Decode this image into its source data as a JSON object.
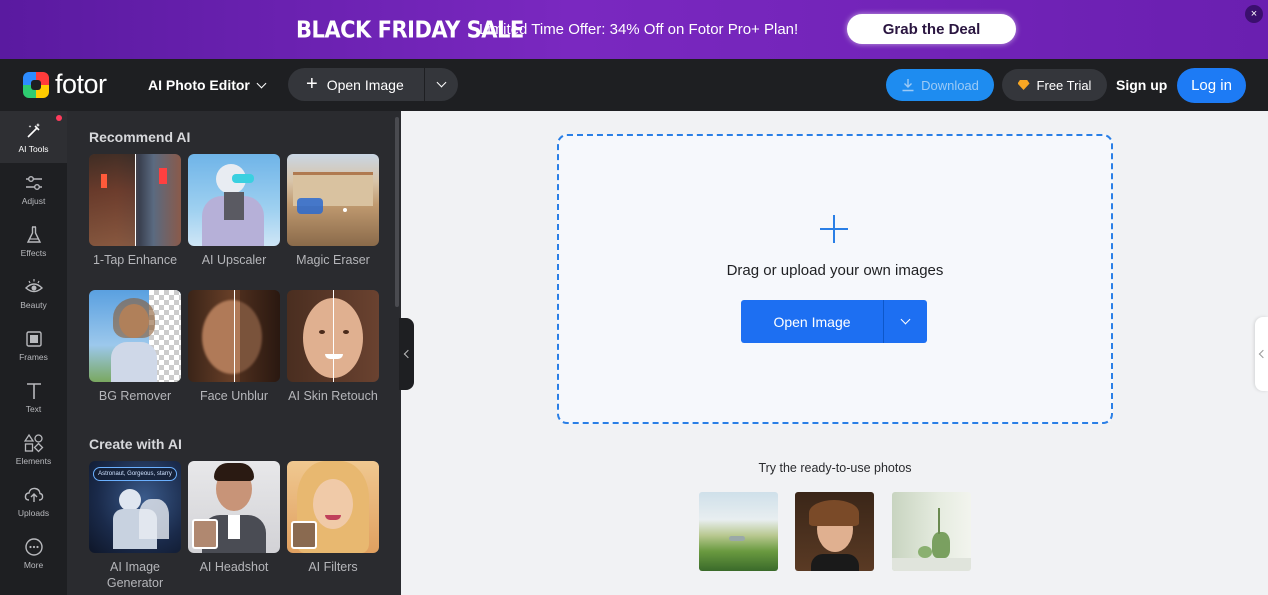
{
  "promo": {
    "title": "BLACK FRIDAY SALE",
    "text": "Limited Time Offer: 34% Off on Fotor Pro+ Plan!",
    "button": "Grab the Deal",
    "close_glyph": "×"
  },
  "header": {
    "logo_text": "fotor",
    "editor_select": "AI Photo Editor",
    "open_image": "Open Image",
    "download": "Download",
    "free_trial": "Free Trial",
    "sign_up": "Sign up",
    "log_in": "Log in"
  },
  "rail": {
    "items": [
      {
        "label": "AI Tools",
        "icon": "magic-wand-icon"
      },
      {
        "label": "Adjust",
        "icon": "sliders-icon"
      },
      {
        "label": "Effects",
        "icon": "flask-icon"
      },
      {
        "label": "Beauty",
        "icon": "eye-icon"
      },
      {
        "label": "Frames",
        "icon": "frame-icon"
      },
      {
        "label": "Text",
        "icon": "text-icon"
      },
      {
        "label": "Elements",
        "icon": "shapes-icon"
      },
      {
        "label": "Uploads",
        "icon": "cloud-upload-icon"
      },
      {
        "label": "More",
        "icon": "more-icon"
      }
    ]
  },
  "panel": {
    "recommend_title": "Recommend AI",
    "recommend": [
      {
        "label": "1-Tap Enhance"
      },
      {
        "label": "AI Upscaler"
      },
      {
        "label": "Magic Eraser"
      },
      {
        "label": "BG Remover"
      },
      {
        "label": "Face Unblur"
      },
      {
        "label": "AI Skin Retouch"
      }
    ],
    "create_title": "Create with AI",
    "create": [
      {
        "label": "AI Image Generator",
        "prompt_chip": "Astronaut, Gorgeous, starry"
      },
      {
        "label": "AI Headshot"
      },
      {
        "label": "AI Filters"
      }
    ]
  },
  "canvas": {
    "drop_text": "Drag or upload your own images",
    "open_button": "Open Image",
    "try_text": "Try the ready-to-use photos"
  },
  "colors": {
    "accent": "#1d6ff2",
    "promo_bg": "#6a1fb0",
    "dark_bg": "#1e1f22",
    "panel_bg": "#2a2b2f"
  }
}
